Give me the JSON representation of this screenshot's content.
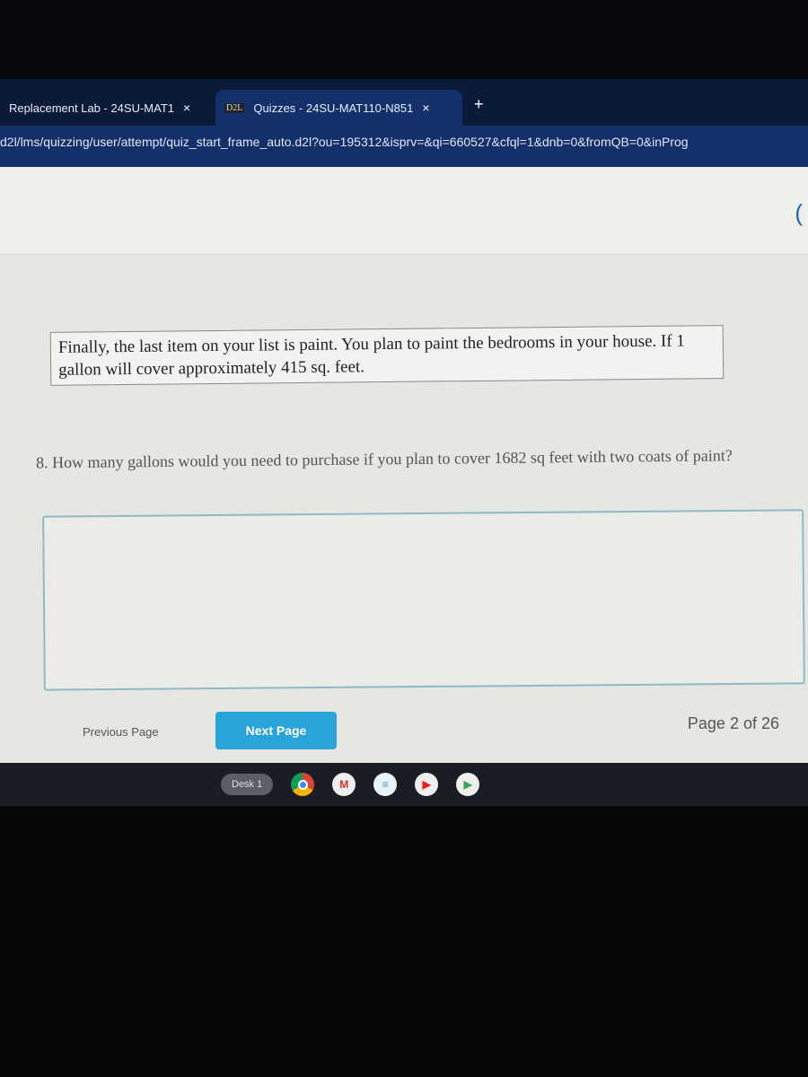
{
  "browser": {
    "tabs": [
      {
        "label": "Replacement Lab - 24SU-MAT1"
      },
      {
        "label": "Quizzes - 24SU-MAT110-N851",
        "favicon": "D2L"
      }
    ],
    "new_tab": "+",
    "close_glyph": "×",
    "url": "d2l/lms/quizzing/user/attempt/quiz_start_frame_auto.d2l?ou=195312&isprv=&qi=660527&cfql=1&dnb=0&fromQB=0&inProg"
  },
  "quiz": {
    "intro": "Finally, the last item on your list is paint. You plan to paint the bedrooms in your house. If 1 gallon will cover approximately 415 sq. feet.",
    "question": "8. How many gallons would you need to purchase if you plan to cover 1682 sq feet with two coats of paint?",
    "answer_value": "",
    "previous_label": "Previous Page",
    "next_label": "Next Page",
    "page_indicator": "Page 2 of 26",
    "accent_color": "#2aa4d8"
  },
  "shelf": {
    "desk_label": "Desk 1",
    "apps": [
      "chrome-icon",
      "gmail-icon",
      "docs-icon",
      "youtube-icon",
      "play-store-icon"
    ]
  }
}
